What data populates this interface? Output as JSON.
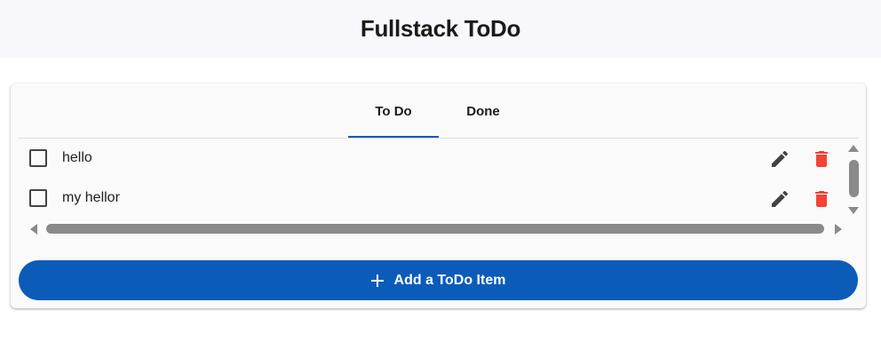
{
  "app": {
    "title": "Fullstack ToDo"
  },
  "tabs": [
    {
      "label": "To Do",
      "selected": true
    },
    {
      "label": "Done",
      "selected": false
    }
  ],
  "todo_items": [
    {
      "text": "hello",
      "checked": false
    },
    {
      "text": "my hellor",
      "checked": false
    }
  ],
  "actions": {
    "add_label": "Add a ToDo Item",
    "add_icon": "plus-icon",
    "edit_icon": "pencil-icon",
    "delete_icon": "trash-icon"
  },
  "colors": {
    "accent": "#0a5cb8",
    "delete": "#f44336",
    "edit": "#424242",
    "header_bg": "#f7f7fc"
  }
}
